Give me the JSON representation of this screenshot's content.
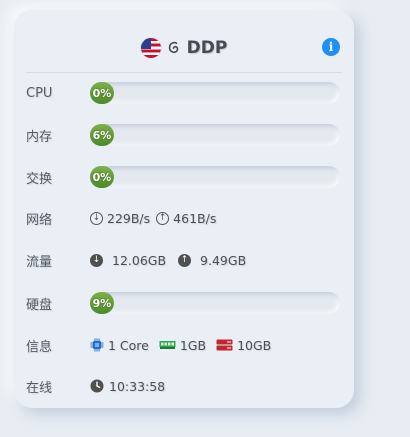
{
  "header": {
    "title": "DDP"
  },
  "rows": {
    "cpu": {
      "label": "CPU",
      "percent_text": "0%",
      "percent": 0
    },
    "memory": {
      "label": "内存",
      "percent_text": "6%",
      "percent": 6
    },
    "swap": {
      "label": "交换",
      "percent_text": "0%",
      "percent": 0
    },
    "network": {
      "label": "网络",
      "down": "229B/s",
      "up": "461B/s"
    },
    "traffic": {
      "label": "流量",
      "down": "12.06GB",
      "up": "9.49GB"
    },
    "disk": {
      "label": "硬盘",
      "percent_text": "9%",
      "percent": 9
    },
    "info": {
      "label": "信息",
      "cpu": "1 Core",
      "ram": "1GB",
      "disk": "10GB"
    },
    "uptime": {
      "label": "在线",
      "value": "10:33:58"
    }
  },
  "icons": {
    "flag": "us-flag-icon",
    "os": "debian-swirl-icon",
    "info": "info-icon",
    "download": "arrow-down-circle-icon",
    "upload": "arrow-up-circle-icon",
    "cpu": "cpu-chip-icon",
    "ram": "ram-icon",
    "disk": "hard-disk-icon",
    "clock": "clock-icon"
  },
  "colors": {
    "bar_fill": "#5f9a36",
    "info_blue": "#1e90f5",
    "cpu_blue": "#1f6fd6",
    "ram_green": "#2aa84a",
    "disk_red": "#c0262d"
  }
}
